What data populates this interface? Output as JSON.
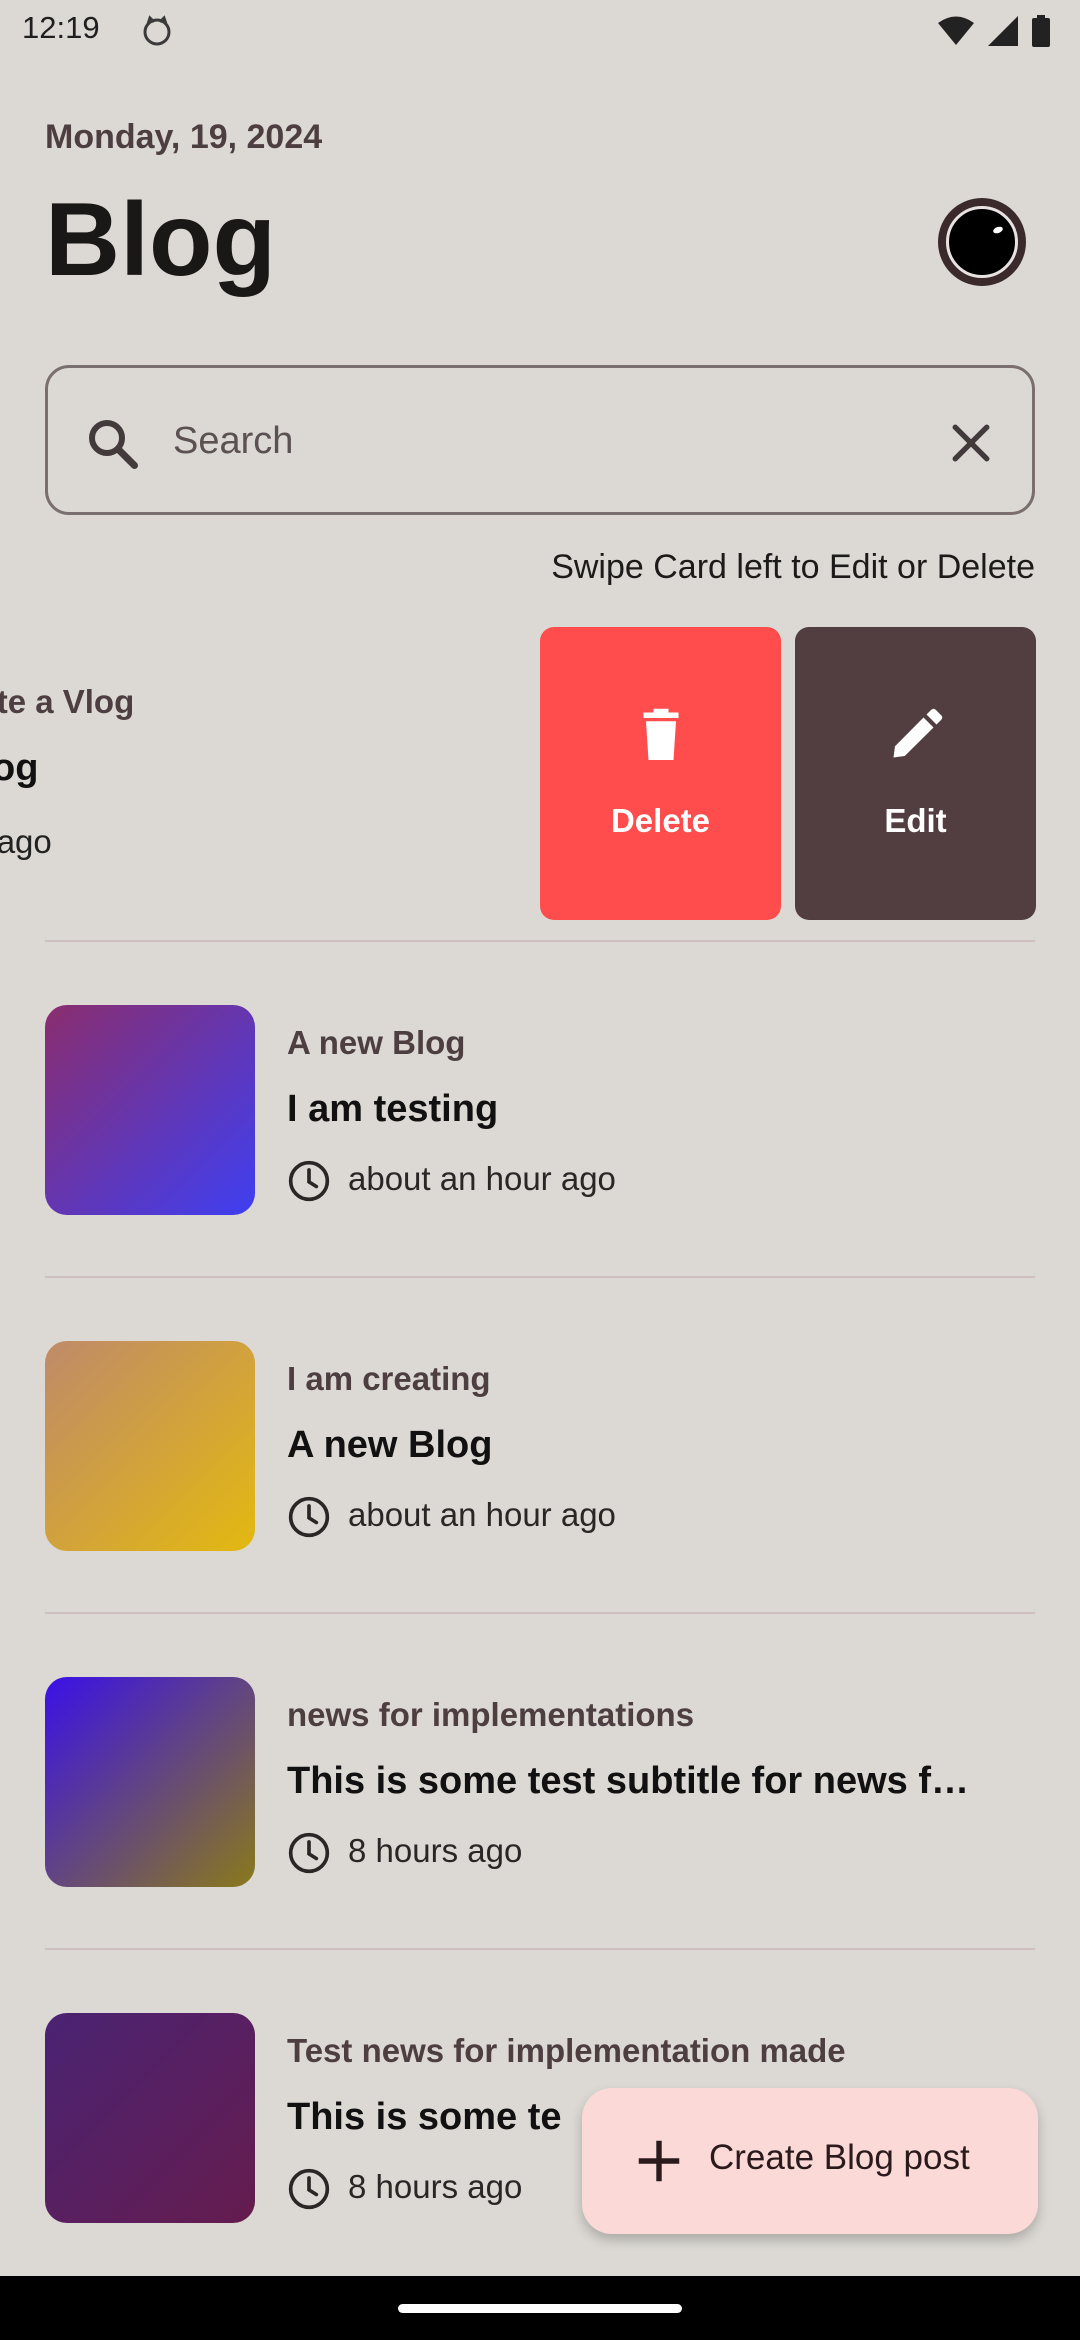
{
  "status": {
    "time": "12:19"
  },
  "header": {
    "date": "Monday, 19, 2024",
    "title": "Blog"
  },
  "search": {
    "placeholder": "Search"
  },
  "hint": "Swipe Card left to Edit or Delete",
  "swiped_post": {
    "category": "eate a Vlog",
    "title": "Blog",
    "time": "nt ago",
    "actions": {
      "delete_label": "Delete",
      "edit_label": "Edit"
    },
    "colors": {
      "delete": "#ff4d4e",
      "edit": "#523d40"
    }
  },
  "posts": [
    {
      "category": "A new Blog",
      "title": "I am testing",
      "time": "about an hour ago",
      "gradient": [
        "#8a2d6e",
        "#3f3ff2"
      ]
    },
    {
      "category": "I am creating",
      "title": "A new Blog",
      "time": "about an hour ago",
      "gradient": [
        "#bf8a6a",
        "#e3b910"
      ]
    },
    {
      "category": "news for implementations",
      "title": "This is some test subtitle for news f…",
      "time": "8 hours ago",
      "gradient": [
        "#3a10e8",
        "#8a7a1a"
      ]
    },
    {
      "category": "Test news for implementation made",
      "title": "This is some te",
      "time": "8 hours ago",
      "gradient": [
        "#4a2373",
        "#651c4e"
      ]
    }
  ],
  "fab": {
    "label": "Create Blog post"
  },
  "icons": {
    "search": "search-icon",
    "clear": "close-icon",
    "delete": "trash-icon",
    "edit": "pencil-icon",
    "time": "clock-icon",
    "add": "plus-icon",
    "avatar": "avatar"
  }
}
